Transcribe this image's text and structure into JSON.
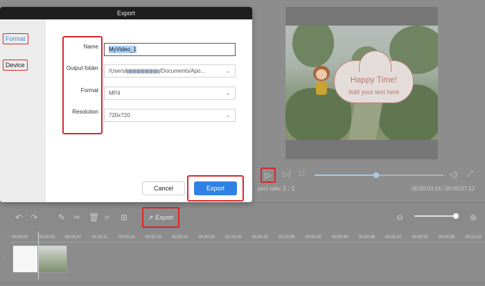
{
  "dialog": {
    "title": "Export",
    "tabs": [
      {
        "label": "Format",
        "active": true
      },
      {
        "label": "Device",
        "active": false
      }
    ],
    "fields": {
      "name_label": "Name",
      "name_value": "MyVideo_1",
      "output_folder_label": "Output folder",
      "output_folder_prefix": "/Users/",
      "output_folder_suffix": "/Documents/Apo...",
      "format_label": "Format",
      "format_value": "MP4",
      "resolution_label": "Resolution",
      "resolution_value": "720x720"
    },
    "cancel_label": "Cancel",
    "export_label": "Export"
  },
  "preview": {
    "overlay_title": "Happy Time!",
    "overlay_subtitle": "Add your text here",
    "aspect_label": "pect ratio",
    "aspect_value": "1 : 1",
    "time_readout": "00:00:03:14 / 00:00:07:12",
    "progress_fraction": 0.48
  },
  "toolbar": {
    "export_label": "Export"
  },
  "timeline": {
    "ticks": [
      "00:00:00",
      "00:00:03",
      "00:00:07",
      "00:00:11",
      "00:00:14",
      "00:00:18",
      "00:00:22",
      "00:00:25",
      "00:00:29",
      "00:00:33",
      "00:00:36",
      "00:00:40",
      "00:00:44",
      "00:00:48",
      "00:00:51",
      "00:00:55",
      "00:00:59",
      "00:01:02"
    ]
  },
  "colors": {
    "accent_blue": "#2f82e4",
    "highlight_red": "#d9252c",
    "active_tab": "#3c8ddc"
  }
}
